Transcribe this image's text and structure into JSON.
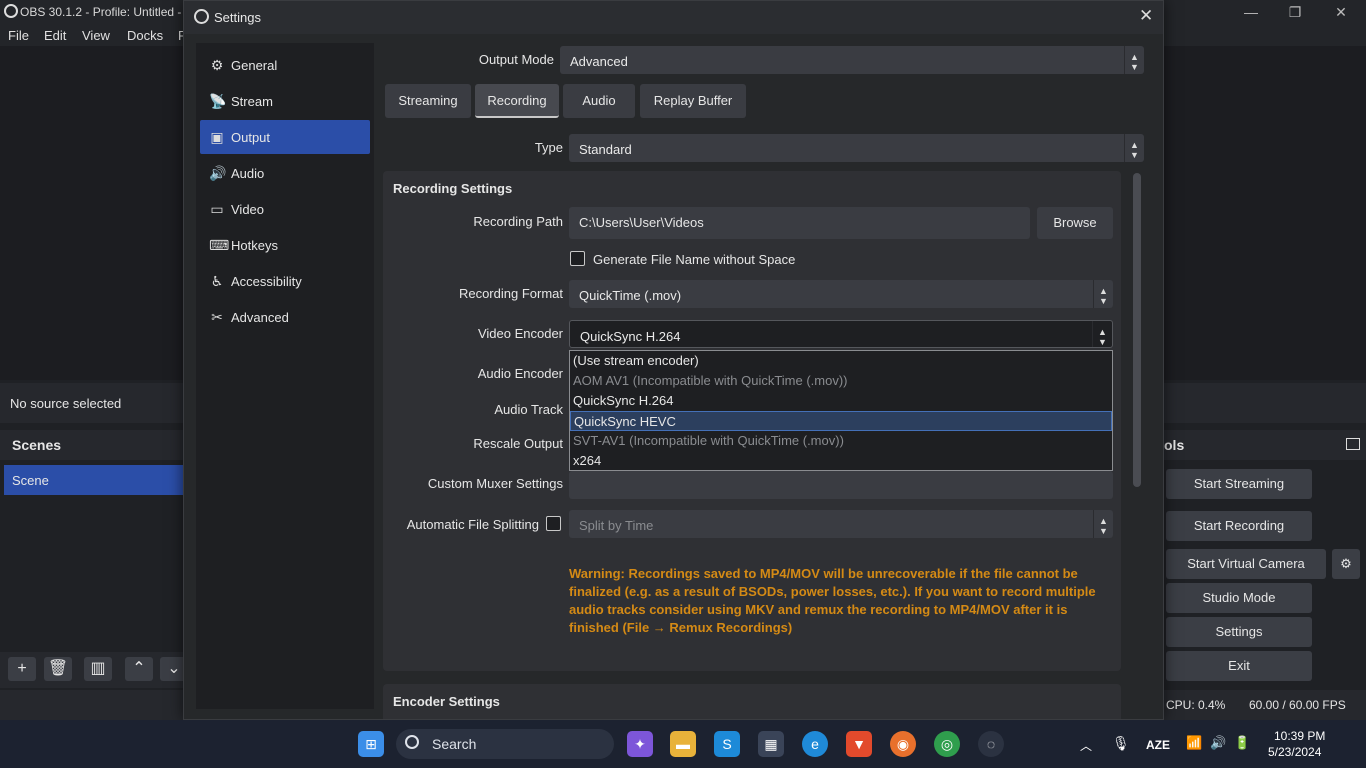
{
  "obs": {
    "title": "OBS 30.1.2 - Profile: Untitled -",
    "menu": [
      "File",
      "Edit",
      "View",
      "Docks",
      "P"
    ],
    "no_source": "No source selected",
    "scenes_title": "Scenes",
    "scene_name": "Scene",
    "controls_title": "ols",
    "controls": [
      "Start Streaming",
      "Start Recording",
      "Start Virtual Camera",
      "Studio Mode",
      "Settings",
      "Exit"
    ],
    "cpu": "CPU: 0.4%",
    "fps": "60.00 / 60.00 FPS"
  },
  "settings": {
    "title": "Settings",
    "close": "✕",
    "sidebar": [
      {
        "label": "General",
        "icon": "gear-icon"
      },
      {
        "label": "Stream",
        "icon": "antenna-icon"
      },
      {
        "label": "Output",
        "icon": "output-icon"
      },
      {
        "label": "Audio",
        "icon": "speaker-icon"
      },
      {
        "label": "Video",
        "icon": "monitor-icon"
      },
      {
        "label": "Hotkeys",
        "icon": "keyboard-icon"
      },
      {
        "label": "Accessibility",
        "icon": "accessibility-icon"
      },
      {
        "label": "Advanced",
        "icon": "tools-icon"
      }
    ],
    "output_mode_label": "Output Mode",
    "output_mode_value": "Advanced",
    "tabs": [
      "Streaming",
      "Recording",
      "Audio",
      "Replay Buffer"
    ],
    "type_label": "Type",
    "type_value": "Standard",
    "recording_settings_title": "Recording Settings",
    "recording_path_label": "Recording Path",
    "recording_path_value": "C:\\Users\\User\\Videos",
    "browse": "Browse",
    "gen_filename": "Generate File Name without Space",
    "recording_format_label": "Recording Format",
    "recording_format_value": "QuickTime (.mov)",
    "video_encoder_label": "Video Encoder",
    "video_encoder_value": "QuickSync H.264",
    "audio_encoder_label": "Audio Encoder",
    "audio_track_label": "Audio Track",
    "rescale_output_label": "Rescale Output",
    "custom_muxer_label": "Custom Muxer Settings",
    "auto_split_label": "Automatic File Splitting",
    "auto_split_value": "Split by Time",
    "encoder_options": [
      "(Use stream encoder)",
      "AOM AV1 (Incompatible with QuickTime (.mov))",
      "QuickSync H.264",
      "QuickSync HEVC",
      "SVT-AV1 (Incompatible with QuickTime (.mov))",
      "x264"
    ],
    "warning": "Warning: Recordings saved to MP4/MOV will be unrecoverable if the file cannot be finalized (e.g. as a result of BSODs, power losses, etc.). If you want to record multiple audio tracks consider using MKV and remux the recording to MP4/MOV after it is finished (File → Remux Recordings)",
    "encoder_settings_title": "Encoder Settings"
  },
  "taskbar": {
    "search": "Search",
    "lang": "AZE",
    "time": "10:39 PM",
    "date": "5/23/2024"
  },
  "colors": {
    "accent": "#2b4ea8",
    "warning": "#d48a15"
  }
}
